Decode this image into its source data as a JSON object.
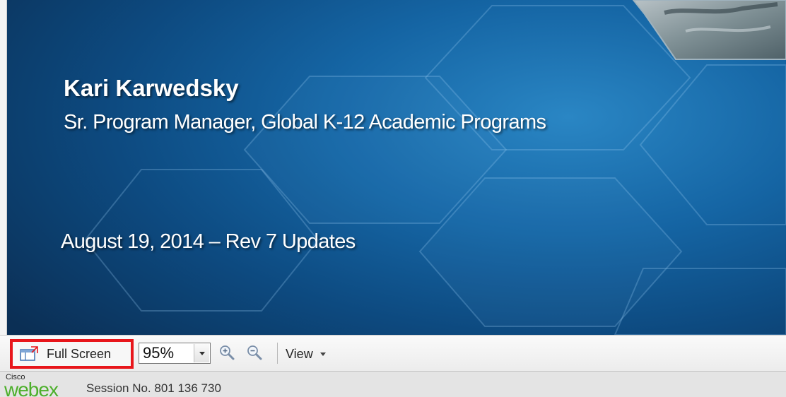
{
  "slide": {
    "presenter_name": "Kari Karwedsky",
    "presenter_title": "Sr. Program Manager, Global K-12 Academic Programs",
    "date_line": "August 19, 2014 – Rev 7 Updates"
  },
  "toolbar": {
    "full_screen_label": "Full Screen",
    "full_screen_icon": "fullscreen-icon",
    "zoom_level": "95%",
    "zoom_in_icon": "zoom-in-icon",
    "zoom_out_icon": "zoom-out-icon",
    "view_label": "View",
    "highlight_color": "#e8161b"
  },
  "status": {
    "brand_top": "Cisco",
    "brand_logo": "webex",
    "session_text": "Session No. 801 136 730",
    "brand_color": "#4caf2a"
  },
  "colors": {
    "slide_background": "#0d4a80",
    "toolbar_background": "#f2f2f2"
  }
}
